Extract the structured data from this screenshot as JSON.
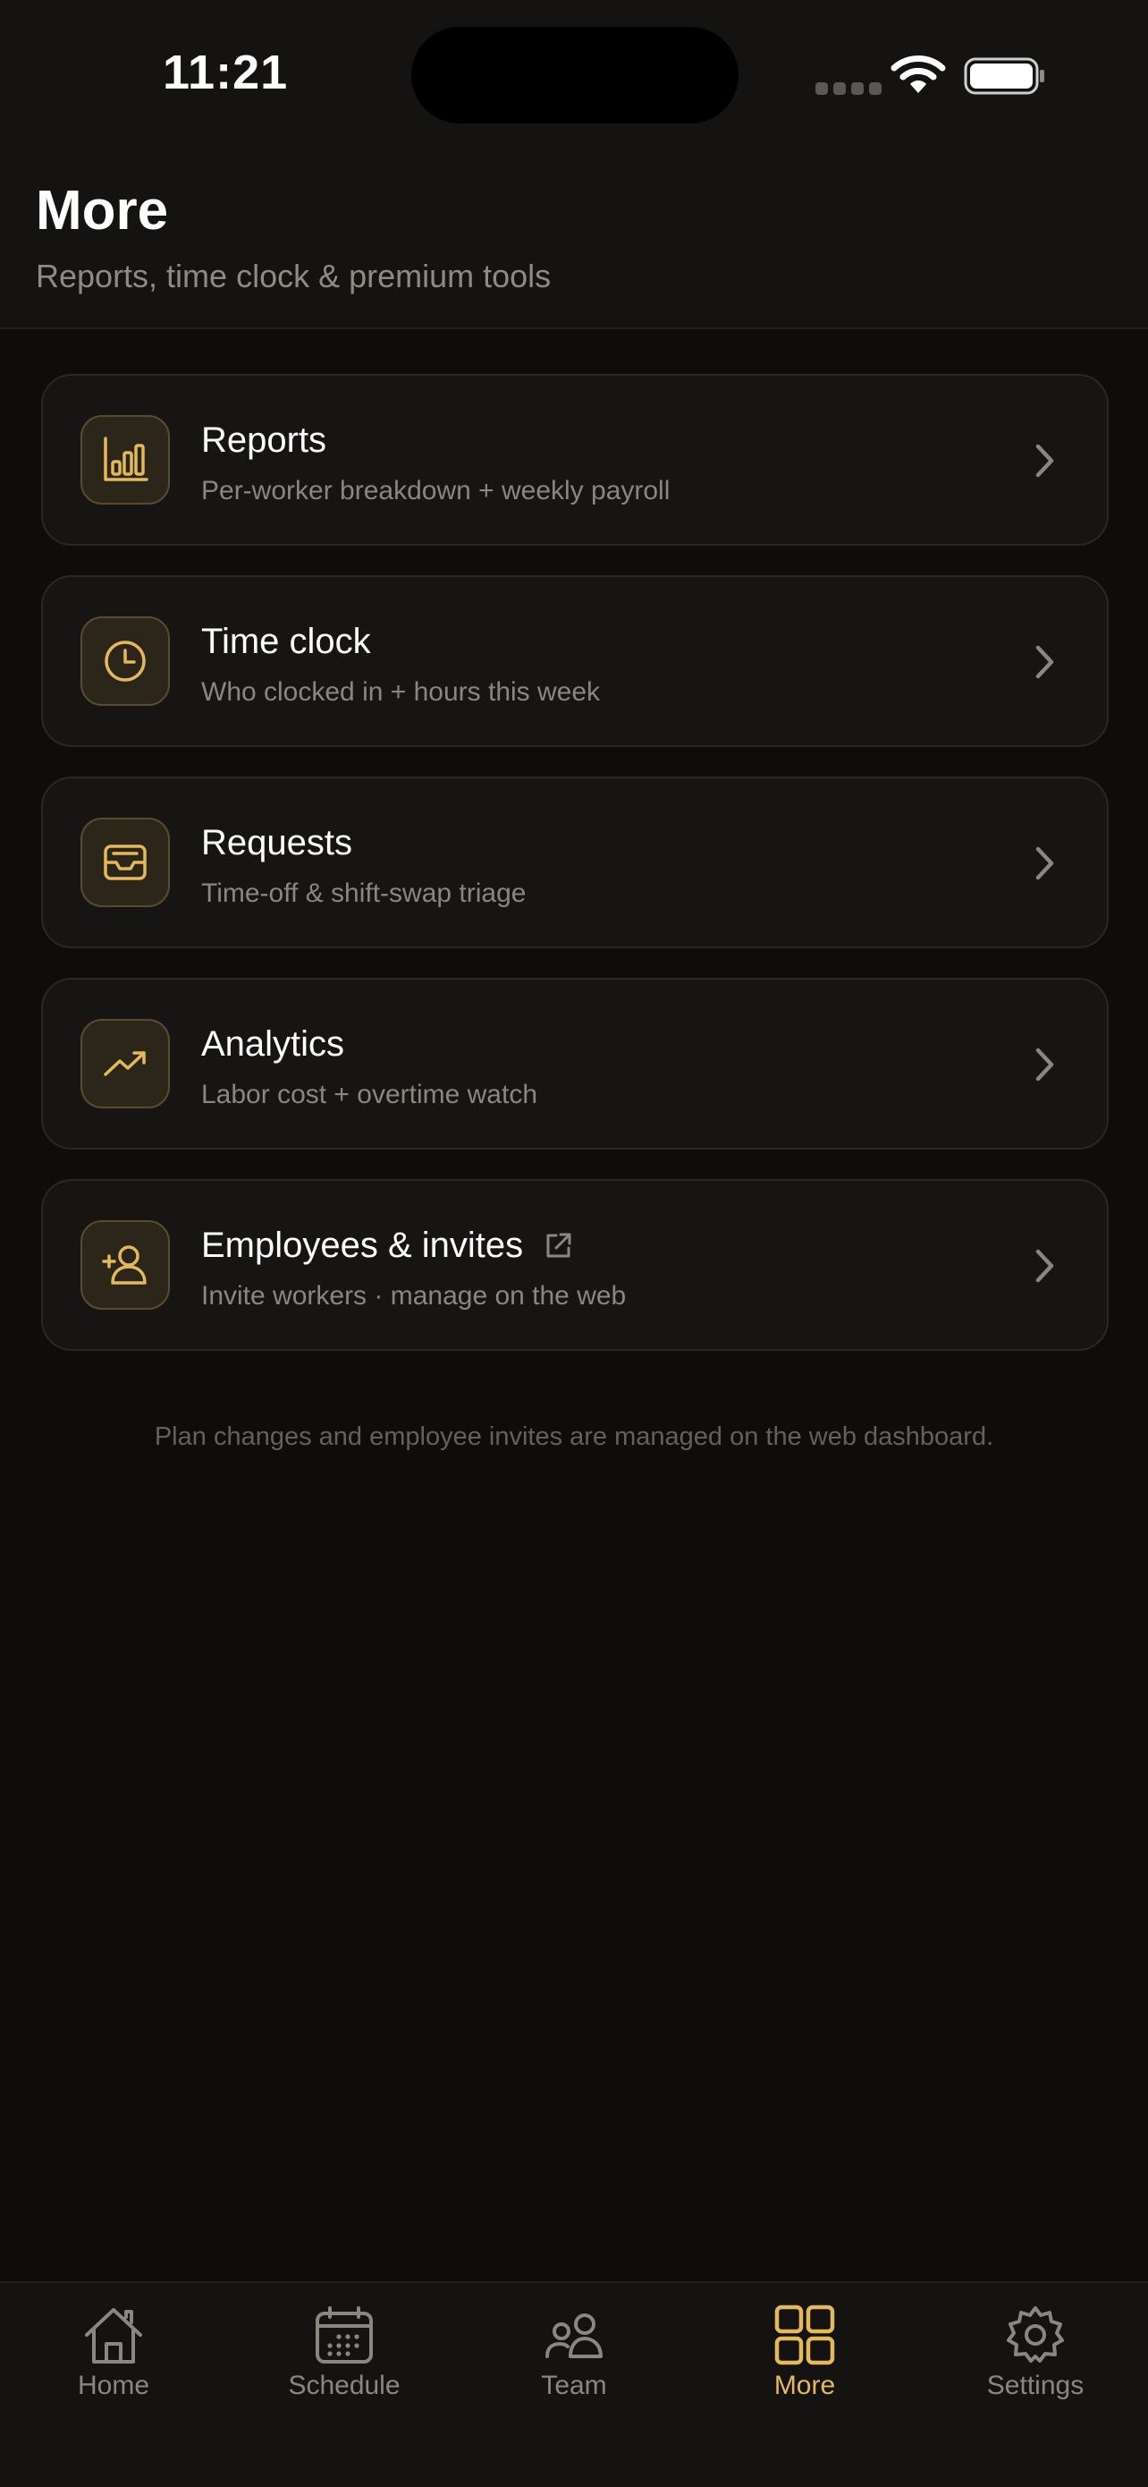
{
  "status_bar": {
    "time": "11:21"
  },
  "header": {
    "title": "More",
    "subtitle": "Reports, time clock & premium tools"
  },
  "menu": {
    "items": [
      {
        "title": "Reports",
        "subtitle": "Per-worker breakdown + weekly payroll",
        "icon": "bar-chart-icon"
      },
      {
        "title": "Time clock",
        "subtitle": "Who clocked in + hours this week",
        "icon": "clock-icon"
      },
      {
        "title": "Requests",
        "subtitle": "Time-off & shift-swap triage",
        "icon": "inbox-icon"
      },
      {
        "title": "Analytics",
        "subtitle": "Labor cost + overtime watch",
        "icon": "trending-up-icon"
      },
      {
        "title": "Employees & invites",
        "subtitle": "Invite workers · manage on the web",
        "icon": "user-plus-icon",
        "external": true
      }
    ]
  },
  "footnote": "Plan changes and employee invites are managed on the web dashboard.",
  "tabbar": {
    "active": "More",
    "tabs": [
      {
        "label": "Home",
        "icon": "home-icon"
      },
      {
        "label": "Schedule",
        "icon": "calendar-icon"
      },
      {
        "label": "Team",
        "icon": "team-icon"
      },
      {
        "label": "More",
        "icon": "grid-icon"
      },
      {
        "label": "Settings",
        "icon": "gear-icon"
      }
    ]
  },
  "colors": {
    "background": "#0e0d0c",
    "card": "#161514",
    "accent": "#e3b95c",
    "muted_text": "#8a8680"
  }
}
